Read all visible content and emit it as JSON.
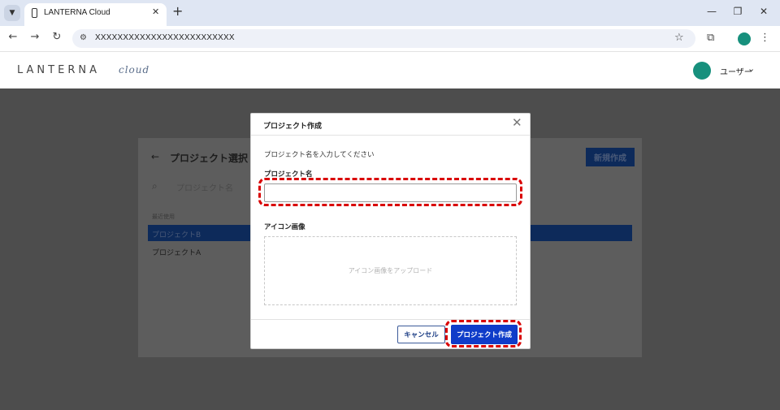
{
  "browser": {
    "tab_title": "LANTERNA Cloud",
    "url": "XXXXXXXXXXXXXXXXXXXXXXXXX"
  },
  "app": {
    "logo_main": "LANTERNA",
    "logo_sub": "cloud",
    "user_name": "ユーザー"
  },
  "background": {
    "page_title": "プロジェクト選択",
    "new_button": "新規作成",
    "search_placeholder": "プロジェクト名",
    "section_label": "最近使用",
    "projects": [
      "プロジェクトB",
      "プロジェクトA"
    ]
  },
  "modal": {
    "title": "プロジェクト作成",
    "description": "プロジェクト名を入力してください",
    "name_label": "プロジェクト名",
    "name_value": "",
    "icon_label": "アイコン画像",
    "upload_text": "アイコン画像をアップロード",
    "cancel_label": "キャンセル",
    "create_label": "プロジェクト作成"
  },
  "colors": {
    "accent": "#0f3cc9",
    "brand_green": "#17907d",
    "highlight": "#d90000"
  },
  "icons": {
    "tab": "phone-icon",
    "close": "close-icon",
    "search": "search-icon",
    "back": "arrow-left-icon"
  }
}
